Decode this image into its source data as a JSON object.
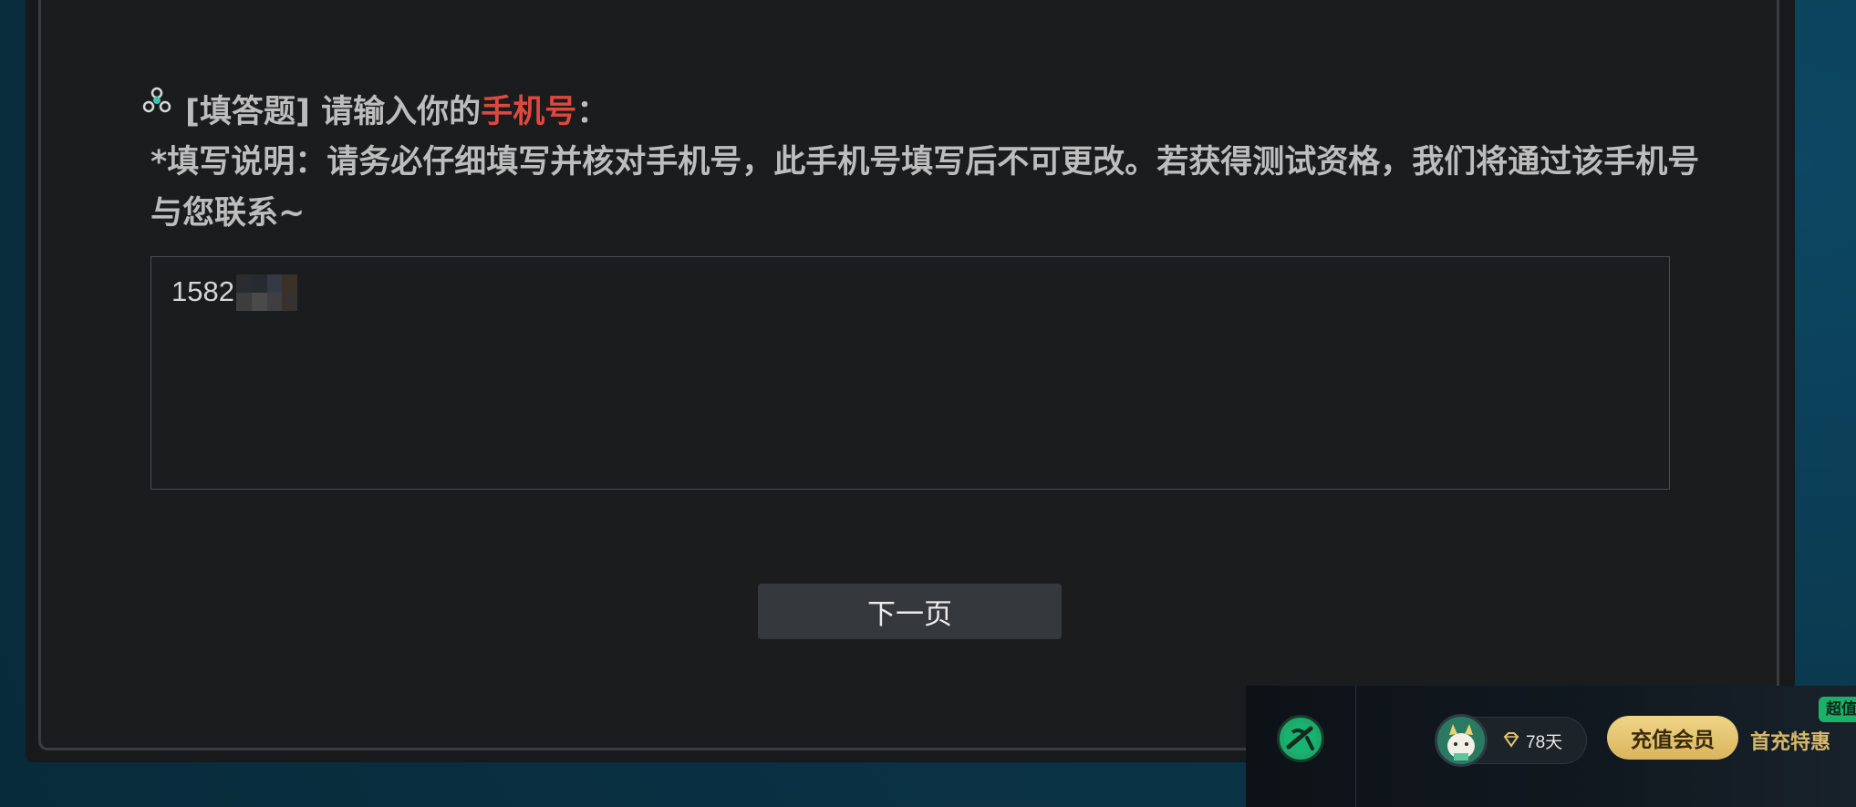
{
  "question": {
    "type_label": "[填答题]",
    "prompt_prefix": " 请输入你的",
    "prompt_highlight": "手机号",
    "prompt_suffix": "：",
    "description": "*填写说明：请务必仔细填写并核对手机号，此手机号填写后不可更改。若获得测试资格，我们将通过该手机号与您联系~"
  },
  "answer": {
    "value_visible": "1582"
  },
  "buttons": {
    "next_label": "下一页"
  },
  "client_bar": {
    "vip_days": "78天",
    "recharge_label": "充值会员",
    "first_charge_label": "首充特惠",
    "badge_label": "超值"
  },
  "colors": {
    "highlight": "#e0483e",
    "accent_green": "#1ea86a",
    "gold": "#d9b45d"
  }
}
